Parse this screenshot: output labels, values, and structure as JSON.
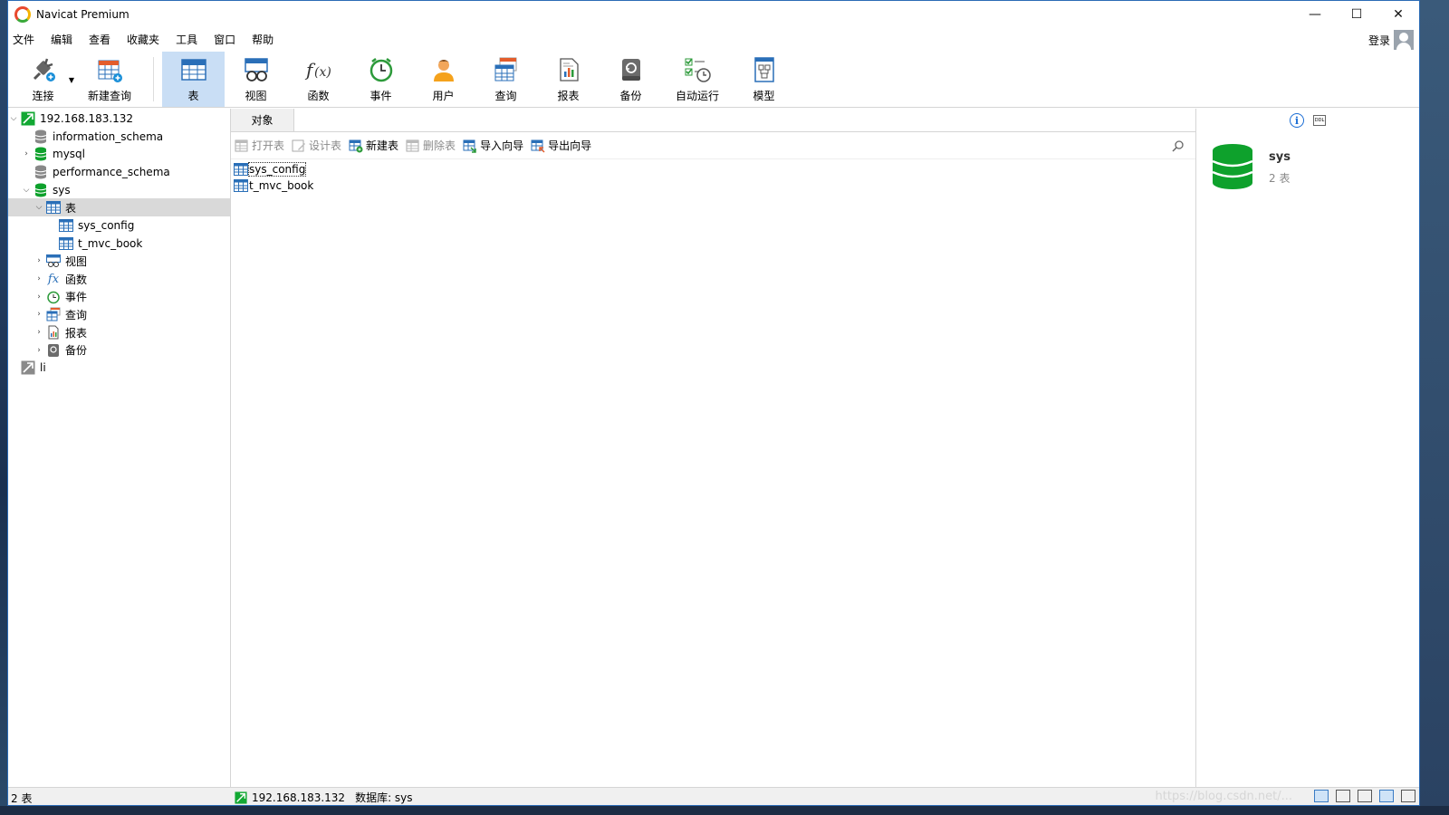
{
  "window": {
    "title": "Navicat Premium",
    "controls": [
      "—",
      "☐",
      "✕"
    ]
  },
  "menu": {
    "items": [
      "文件",
      "编辑",
      "查看",
      "收藏夹",
      "工具",
      "窗口",
      "帮助"
    ],
    "login": "登录"
  },
  "toolbar": {
    "items": [
      {
        "label": "连接",
        "icon": "plug-icon"
      },
      {
        "label": "新建查询",
        "icon": "new-query-icon"
      },
      {
        "label": "表",
        "icon": "table-icon",
        "active": true
      },
      {
        "label": "视图",
        "icon": "view-icon"
      },
      {
        "label": "函数",
        "icon": "function-icon"
      },
      {
        "label": "事件",
        "icon": "clock-icon"
      },
      {
        "label": "用户",
        "icon": "user-icon"
      },
      {
        "label": "查询",
        "icon": "query-icon"
      },
      {
        "label": "报表",
        "icon": "report-icon"
      },
      {
        "label": "备份",
        "icon": "backup-icon"
      },
      {
        "label": "自动运行",
        "icon": "automation-icon"
      },
      {
        "label": "模型",
        "icon": "model-icon"
      }
    ]
  },
  "tree": {
    "connection": "192.168.183.132",
    "databases": [
      "information_schema",
      "mysql",
      "performance_schema",
      "sys"
    ],
    "tables_node": "表",
    "tables": [
      "sys_config",
      "t_mvc_book"
    ],
    "other_nodes": [
      "视图",
      "函数",
      "事件",
      "查询",
      "报表",
      "备份"
    ],
    "second_connection": "li"
  },
  "center": {
    "tab": "对象",
    "actions": [
      {
        "label": "打开表",
        "enabled": false
      },
      {
        "label": "设计表",
        "enabled": false
      },
      {
        "label": "新建表",
        "enabled": true
      },
      {
        "label": "删除表",
        "enabled": false
      },
      {
        "label": "导入向导",
        "enabled": true
      },
      {
        "label": "导出向导",
        "enabled": true
      }
    ],
    "objects": [
      "sys_config",
      "t_mvc_book"
    ]
  },
  "info": {
    "db_name": "sys",
    "table_count": "2 表"
  },
  "status": {
    "count": "2 表",
    "connection": "192.168.183.132",
    "database": "数据库: sys",
    "watermark": "https://blog.csdn.net/..."
  },
  "colors": {
    "db_green": "#0ea12c",
    "active_tool": "#c9def5",
    "accent_blue": "#1a6dd4"
  }
}
